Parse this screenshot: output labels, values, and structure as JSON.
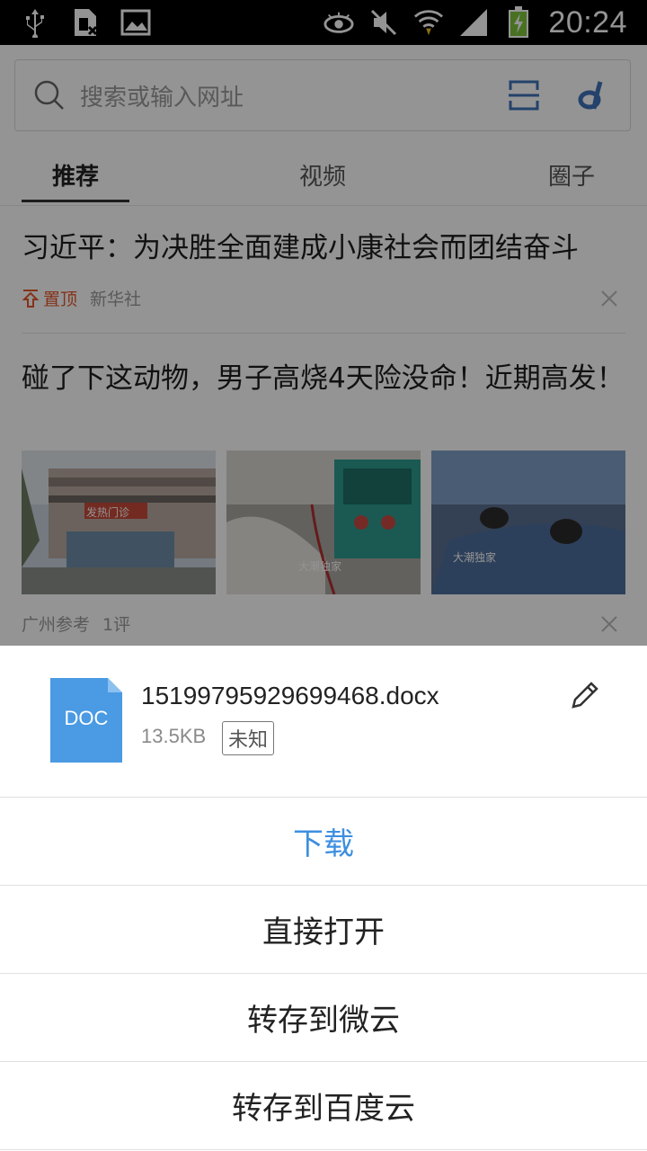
{
  "status_bar": {
    "time": "20:24",
    "left_icons": [
      "usb-icon",
      "sim-icon",
      "image-icon"
    ],
    "right_icons": [
      "eye-icon",
      "mute-icon",
      "wifi-icon",
      "signal-icon",
      "battery-charging-icon"
    ]
  },
  "browser": {
    "search": {
      "placeholder": "搜索或输入网址"
    },
    "tabs": [
      {
        "label": "推荐",
        "active": true
      },
      {
        "label": "视频",
        "active": false
      },
      {
        "label": "圈子",
        "active": false
      }
    ],
    "feed": [
      {
        "title": "习近平：为决胜全面建成小康社会而团结奋斗",
        "pinned_label": "置顶",
        "source": "新华社"
      },
      {
        "title": "碰了下这动物，男子高烧4天险没命！近期高发！",
        "source": "广州参考",
        "comments": "1评",
        "thumb_labels": [
          "发热门诊",
          "大潮独家",
          "大潮独家"
        ]
      }
    ]
  },
  "sheet": {
    "file": {
      "icon_label": "DOC",
      "name": "15199795929699468.docx",
      "size": "13.5KB",
      "type_badge": "未知"
    },
    "actions": [
      {
        "label": "下载",
        "primary": true
      },
      {
        "label": "直接打开"
      },
      {
        "label": "转存到微云"
      },
      {
        "label": "转存到百度云"
      }
    ]
  },
  "colors": {
    "accent": "#3d8fe0",
    "doc_icon": "#4a9ae4",
    "pinned": "#e5572b"
  }
}
